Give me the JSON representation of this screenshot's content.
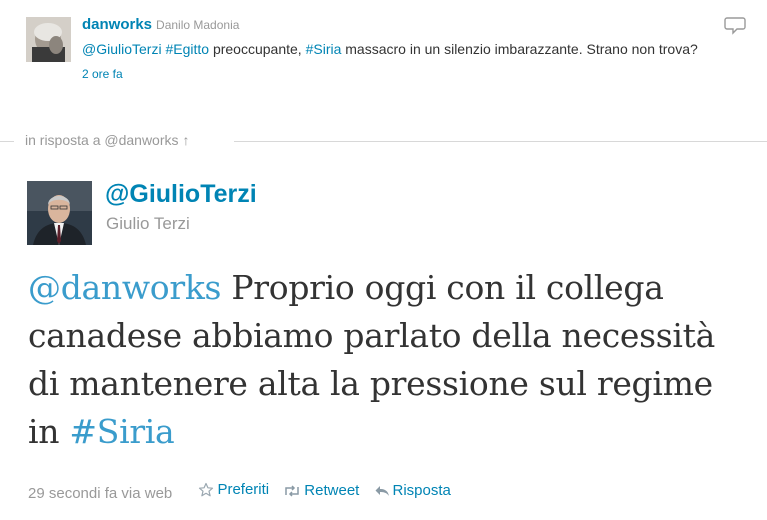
{
  "original_tweet": {
    "screen_name": "danworks",
    "display_name": "Danilo Madonia",
    "text_parts": {
      "mention": "@GiulioTerzi",
      "hashtag_egitto": "#Egitto",
      "text_a": " preoccupante, ",
      "hashtag_siria": "#Siria",
      "text_b": " massacro in un silenzio imbarazzante. Strano non trova?"
    },
    "timestamp": "2 ore fa",
    "reply_icon": "reply-speech-bubble-icon"
  },
  "divider": {
    "label": "in risposta a @danworks",
    "arrow": "↑"
  },
  "main_tweet": {
    "screen_name": "@GiulioTerzi",
    "display_name": "Giulio Terzi",
    "text_parts": {
      "mention": "@danworks",
      "text_a": " Proprio oggi con il collega canadese abbiamo parlato della necessità di mantenere alta la pressione sul regime in ",
      "hashtag": "#Siria"
    },
    "meta": "29 secondi fa via web",
    "actions": {
      "favorite": "Preferiti",
      "retweet": "Retweet",
      "reply": "Risposta"
    }
  },
  "colors": {
    "link": "#0084b4",
    "muted": "#999999",
    "text": "#333333"
  }
}
